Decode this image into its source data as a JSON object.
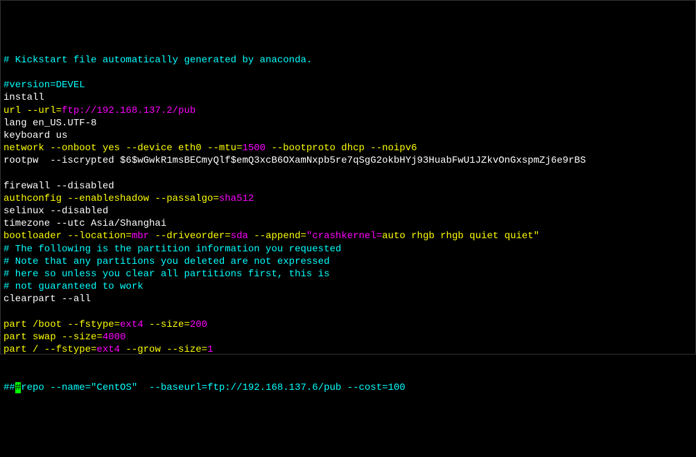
{
  "lines": [
    {
      "id": "l1",
      "segs": [
        {
          "t": "# Kickstart file automatically generated by anaconda.",
          "c": "cyan"
        }
      ]
    },
    {
      "id": "l2",
      "segs": [
        {
          "t": " ",
          "c": "white"
        }
      ]
    },
    {
      "id": "l3",
      "segs": [
        {
          "t": "#version=DEVEL",
          "c": "cyan"
        }
      ]
    },
    {
      "id": "l4",
      "segs": [
        {
          "t": "install",
          "c": "white"
        }
      ]
    },
    {
      "id": "l5",
      "segs": [
        {
          "t": "url --url=",
          "c": "yellow"
        },
        {
          "t": "ftp://192.168.137.2/pub",
          "c": "magenta"
        }
      ]
    },
    {
      "id": "l6",
      "segs": [
        {
          "t": "lang en_US.UTF-8",
          "c": "white"
        }
      ]
    },
    {
      "id": "l7",
      "segs": [
        {
          "t": "keyboard us",
          "c": "white"
        }
      ]
    },
    {
      "id": "l8",
      "segs": [
        {
          "t": "network --onboot yes --device eth0 --mtu=",
          "c": "yellow"
        },
        {
          "t": "1500",
          "c": "magenta"
        },
        {
          "t": " --bootproto dhcp --noipv6",
          "c": "yellow"
        }
      ]
    },
    {
      "id": "l9",
      "segs": [
        {
          "t": "rootpw  --iscrypted $6$wGwkR1msBECmyQlf$emQ3xcB6OXamNxpb5re7qSgG2okbHYj93HuabFwU1JZkvOnGxspmZj6e9rBS",
          "c": "white"
        }
      ]
    },
    {
      "id": "l10",
      "segs": [
        {
          "t": " ",
          "c": "white"
        }
      ]
    },
    {
      "id": "l11",
      "segs": [
        {
          "t": "firewall --disabled",
          "c": "white"
        }
      ]
    },
    {
      "id": "l12",
      "segs": [
        {
          "t": "authconfig --enableshadow --passalgo=",
          "c": "yellow"
        },
        {
          "t": "sha512",
          "c": "magenta"
        }
      ]
    },
    {
      "id": "l13",
      "segs": [
        {
          "t": "selinux --disabled",
          "c": "white"
        }
      ]
    },
    {
      "id": "l14",
      "segs": [
        {
          "t": "timezone --utc Asia/Shanghai",
          "c": "white"
        }
      ]
    },
    {
      "id": "l15",
      "segs": [
        {
          "t": "bootloader --location=",
          "c": "yellow"
        },
        {
          "t": "mbr",
          "c": "magenta"
        },
        {
          "t": " --driveorder=",
          "c": "yellow"
        },
        {
          "t": "sda",
          "c": "magenta"
        },
        {
          "t": " --append=",
          "c": "yellow"
        },
        {
          "t": "\"crashkernel=",
          "c": "magenta"
        },
        {
          "t": "auto rhgb rhgb quiet quiet\"",
          "c": "yellow"
        }
      ]
    },
    {
      "id": "l16",
      "segs": [
        {
          "t": "# The following is the partition information you requested",
          "c": "cyan"
        }
      ]
    },
    {
      "id": "l17",
      "segs": [
        {
          "t": "# Note that any partitions you deleted are not expressed",
          "c": "cyan"
        }
      ]
    },
    {
      "id": "l18",
      "segs": [
        {
          "t": "# here so unless you clear all partitions first, this is",
          "c": "cyan"
        }
      ]
    },
    {
      "id": "l19",
      "segs": [
        {
          "t": "# not guaranteed to work",
          "c": "cyan"
        }
      ]
    },
    {
      "id": "l20",
      "segs": [
        {
          "t": "clearpart --all",
          "c": "white"
        }
      ]
    },
    {
      "id": "l21",
      "segs": [
        {
          "t": " ",
          "c": "white"
        }
      ]
    },
    {
      "id": "l22",
      "segs": [
        {
          "t": "part /boot --fstype=",
          "c": "yellow"
        },
        {
          "t": "ext4",
          "c": "magenta"
        },
        {
          "t": " --size=",
          "c": "yellow"
        },
        {
          "t": "200",
          "c": "magenta"
        }
      ]
    },
    {
      "id": "l23",
      "segs": [
        {
          "t": "part swap --size=",
          "c": "yellow"
        },
        {
          "t": "4000",
          "c": "magenta"
        }
      ]
    },
    {
      "id": "l24",
      "segs": [
        {
          "t": "part / --fstype=",
          "c": "yellow"
        },
        {
          "t": "ext4",
          "c": "magenta"
        },
        {
          "t": " --grow --size=",
          "c": "yellow"
        },
        {
          "t": "1",
          "c": "magenta"
        }
      ]
    },
    {
      "id": "l25",
      "segs": [
        {
          "t": " ",
          "c": "white"
        }
      ]
    },
    {
      "id": "l26",
      "segs": [
        {
          "t": " ",
          "c": "white"
        }
      ]
    },
    {
      "id": "l27",
      "segs": [
        {
          "t": "##",
          "c": "cyan"
        },
        {
          "t": "#",
          "c": "cursor"
        },
        {
          "t": "repo --name=\"CentOS\"  --baseurl=ftp://192.168.137.6/pub --cost=100",
          "c": "cyan"
        }
      ]
    }
  ]
}
